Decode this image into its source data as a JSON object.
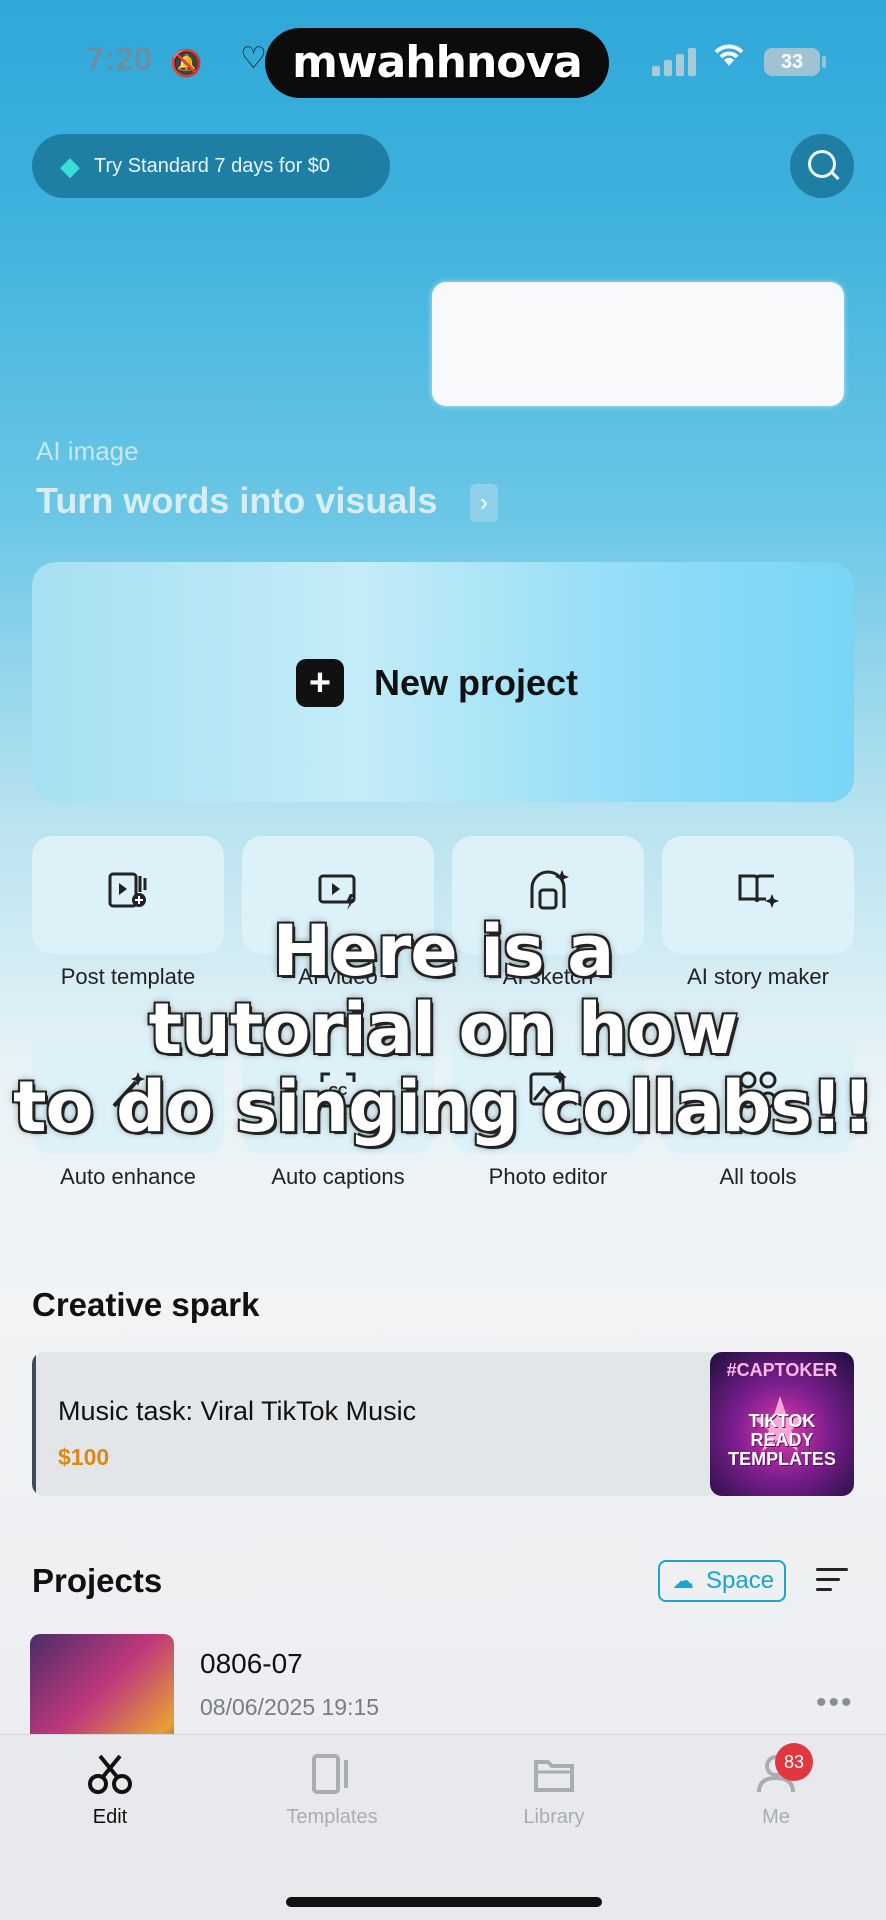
{
  "status_bar": {
    "time": "7:20",
    "battery": "33",
    "username": "mwahhnova"
  },
  "header": {
    "trial_label": "Try Standard 7 days for $0"
  },
  "ai_image": {
    "label": "AI image",
    "headline": "Turn words into visuals",
    "chevron": "›"
  },
  "new_project": {
    "label": "New project",
    "plus": "+"
  },
  "tools": [
    {
      "label": "Post template",
      "icon": "video-plus-icon"
    },
    {
      "label": "AI video",
      "icon": "video-lightning-icon"
    },
    {
      "label": "AI sketch",
      "icon": "camera-sparkle-icon"
    },
    {
      "label": "AI story maker",
      "icon": "book-sparkle-icon"
    },
    {
      "label": "Auto enhance",
      "icon": "magic-wand-icon"
    },
    {
      "label": "Auto captions",
      "icon": "captions-icon"
    },
    {
      "label": "Photo editor",
      "icon": "image-edit-icon"
    },
    {
      "label": "All tools",
      "icon": "grid-icon"
    }
  ],
  "overlay_caption": {
    "line1": "Here is a",
    "line2": "tutorial on how",
    "line3": "to do singing collabs!!"
  },
  "creative_spark": {
    "title": "Creative spark",
    "card_title": "Music task: Viral TikTok Music",
    "card_price": "$100",
    "thumb_tag": "#CAPTOKER",
    "thumb_line1": "TIKTOK",
    "thumb_line2": "READY",
    "thumb_line3": "TEMPLATES"
  },
  "projects": {
    "title": "Projects",
    "space_label": "Space",
    "items": [
      {
        "name": "0806-07",
        "date": "08/06/2025 19:15"
      }
    ]
  },
  "tabbar": {
    "tabs": [
      {
        "label": "Edit",
        "icon": "scissors-icon"
      },
      {
        "label": "Templates",
        "icon": "templates-icon"
      },
      {
        "label": "Library",
        "icon": "folder-icon"
      },
      {
        "label": "Me",
        "icon": "person-icon"
      }
    ],
    "me_badge": "83"
  }
}
